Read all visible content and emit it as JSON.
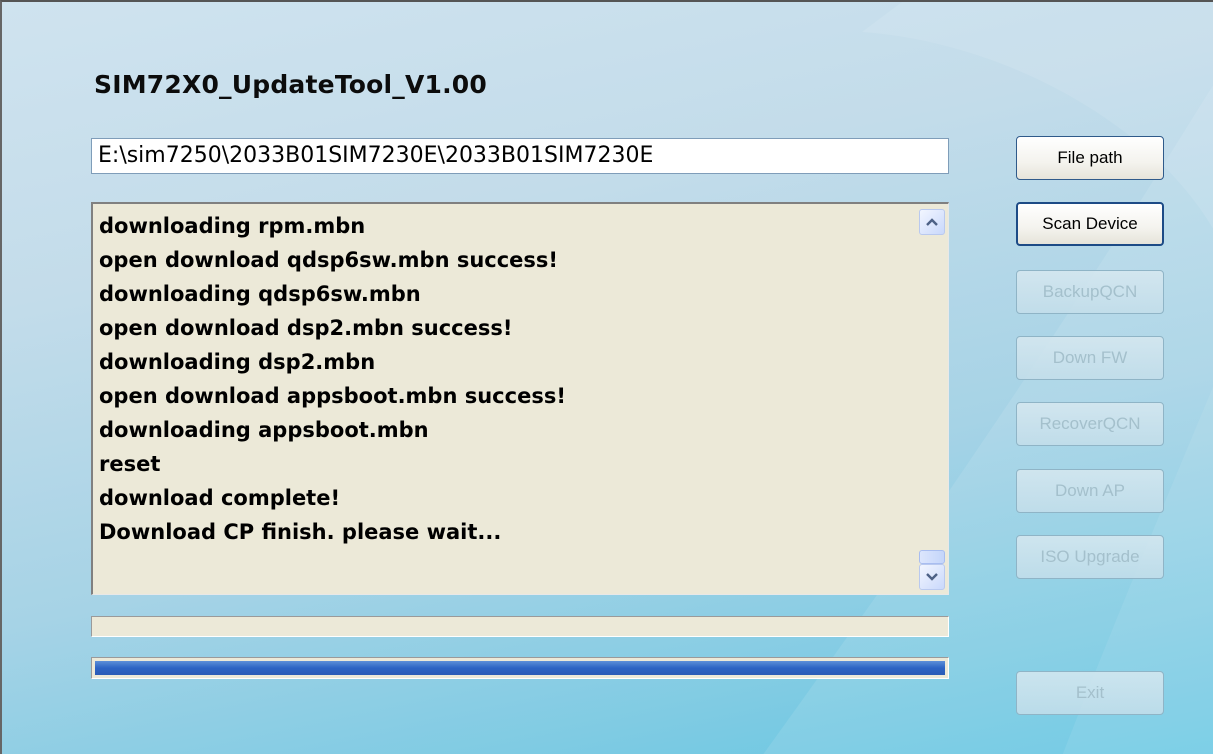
{
  "app": {
    "title": "SIM72X0_UpdateTool_V1.00"
  },
  "file_path_field": {
    "value": "E:\\sim7250\\2033B01SIM7230E\\2033B01SIM7230E"
  },
  "log": {
    "lines": [
      "downloading rpm.mbn",
      "open download qdsp6sw.mbn success!",
      "downloading qdsp6sw.mbn",
      "open download dsp2.mbn success!",
      "downloading dsp2.mbn",
      "open download appsboot.mbn success!",
      "downloading appsboot.mbn",
      "reset",
      "download complete!",
      "Download CP finish. please wait..."
    ]
  },
  "progress": {
    "bar1_fraction": 0,
    "bar2_fraction": 1.0
  },
  "buttons": {
    "file_path": "File path",
    "scan_device": "Scan Device",
    "backup_qcn": "BackupQCN",
    "down_fw": "Down FW",
    "recover_qcn": "RecoverQCN",
    "down_ap": "Down AP",
    "iso_upgrade": "ISO Upgrade",
    "exit": "Exit"
  },
  "colors": {
    "background_top": "#cfe3ef",
    "background_bottom": "#63c6e2",
    "progress_fill": "#2c64c4",
    "log_background": "#ece9d8"
  }
}
